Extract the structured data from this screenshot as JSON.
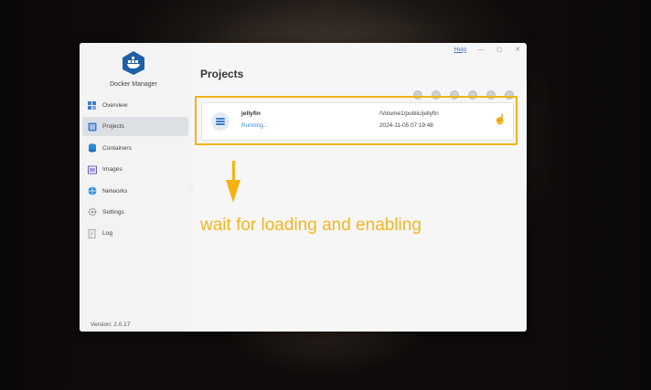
{
  "window": {
    "help_label": "Help",
    "controls": [
      "—",
      "◻",
      "✕"
    ]
  },
  "sidebar": {
    "app_name": "Docker Manager",
    "items": [
      {
        "label": "Overview",
        "icon": "overview-icon",
        "active": false
      },
      {
        "label": "Projects",
        "icon": "projects-icon",
        "active": true
      },
      {
        "label": "Containers",
        "icon": "containers-icon",
        "active": false
      },
      {
        "label": "Images",
        "icon": "images-icon",
        "active": false
      },
      {
        "label": "Networks",
        "icon": "networks-icon",
        "active": false
      },
      {
        "label": "Settings",
        "icon": "settings-icon",
        "active": false
      },
      {
        "label": "Log",
        "icon": "log-icon",
        "active": false
      }
    ],
    "version": "Version: 2.0.17"
  },
  "main": {
    "title": "Projects",
    "project": {
      "name": "jellyfin",
      "status": "Running...",
      "path": "/Volume1/public/jellyfin",
      "datetime": "2024-11-05 07:19:48"
    }
  },
  "overlay": {
    "annotation": "wait for loading and enabling",
    "accent_color": "#f5b51e"
  }
}
